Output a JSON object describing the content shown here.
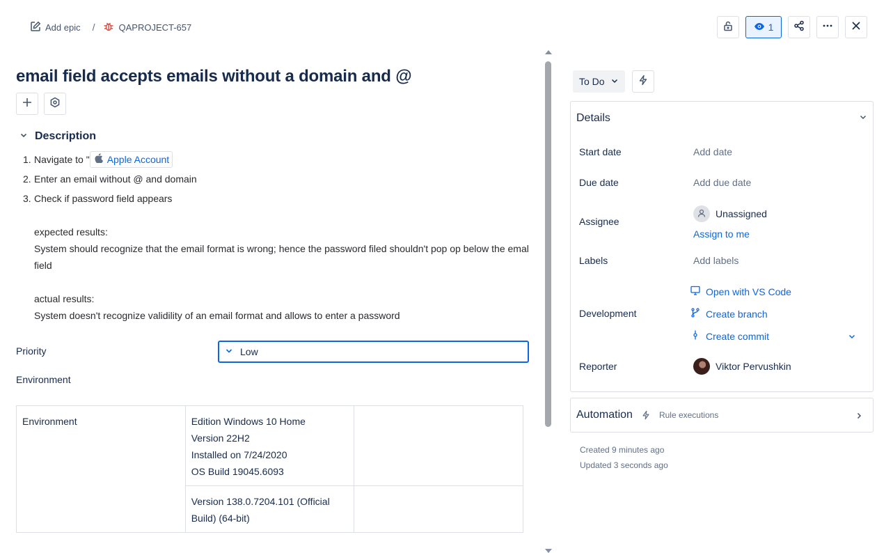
{
  "breadcrumb": {
    "add_epic": "Add epic",
    "separator": "/",
    "issue_key": "QAPROJECT-657"
  },
  "toolbar": {
    "watch_count": "1"
  },
  "issue": {
    "title": "email field accepts emails without a domain and @"
  },
  "description": {
    "heading": "Description",
    "steps": [
      {
        "num": "1.",
        "text": "Navigate to \"",
        "link": "Apple Account"
      },
      {
        "num": "2.",
        "text": "Enter an email without @ and domain"
      },
      {
        "num": "3.",
        "text": "Check if password field appears"
      }
    ],
    "expected_label": "expected results:",
    "expected_text": "System should recognize that the email format  is wrong; hence the password filed shouldn't pop op below the emal field",
    "actual_label": "actual results:",
    "actual_text": "System doesn't recognize validility of an email format and allows to enter a password"
  },
  "fields": {
    "priority_label": "Priority",
    "priority_value": "Low",
    "environment_label": "Environment"
  },
  "env_table": {
    "row1": {
      "c1": "Environment",
      "c2_lines": [
        "Edition Windows 10 Home",
        "Version 22H2",
        "Installed on 7/24/2020",
        "OS Build 19045.6093"
      ],
      "c3": ""
    },
    "row2": {
      "c2_lines": [
        "Version 138.0.7204.101 (Official",
        "Build) (64-bit)"
      ],
      "c3": ""
    }
  },
  "status": {
    "label": "To Do"
  },
  "details": {
    "heading": "Details",
    "start_date_label": "Start date",
    "start_date_value": "Add date",
    "due_date_label": "Due date",
    "due_date_value": "Add due date",
    "assignee_label": "Assignee",
    "assignee_value": "Unassigned",
    "assign_to_me": "Assign to me",
    "labels_label": "Labels",
    "labels_value": "Add labels",
    "development_label": "Development",
    "dev_links": [
      "Open with VS Code",
      "Create branch",
      "Create commit"
    ],
    "reporter_label": "Reporter",
    "reporter_value": "Viktor Pervushkin"
  },
  "automation": {
    "title": "Automation",
    "subtitle": "Rule executions"
  },
  "meta": {
    "created": "Created 9 minutes ago",
    "updated": "Updated 3 seconds ago"
  },
  "colors": {
    "link": "#0c66e4",
    "text": "#172b4d",
    "subtle": "#626f86",
    "border": "#dcdfe4",
    "bug": "#e2483d"
  }
}
